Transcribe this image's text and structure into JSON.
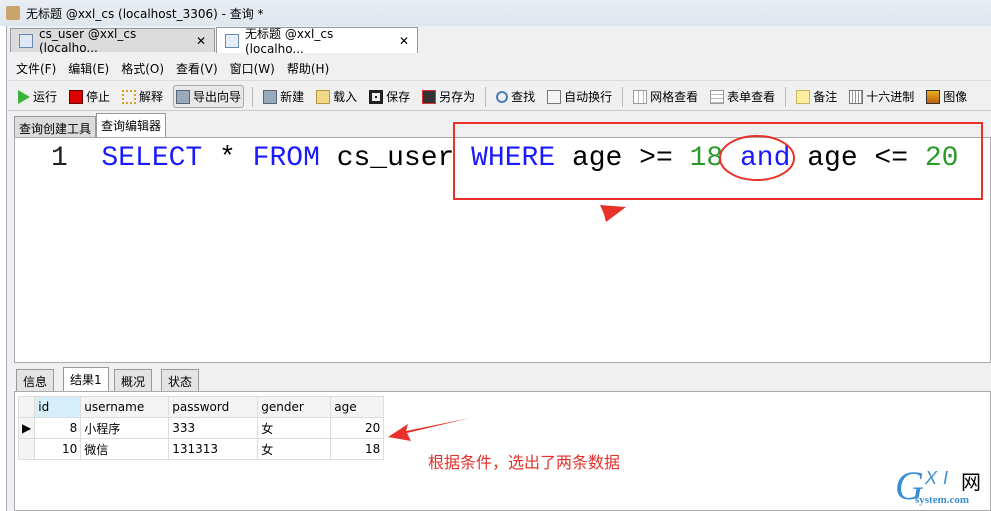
{
  "window": {
    "title": "无标题 @xxl_cs (localhost_3306) - 查询 *"
  },
  "doc_tabs": [
    {
      "label": "cs_user @xxl_cs (localho...",
      "close": "✕"
    },
    {
      "label": "无标题 @xxl_cs (localho...",
      "close": "✕"
    }
  ],
  "menu": [
    "文件(F)",
    "编辑(E)",
    "格式(O)",
    "查看(V)",
    "窗口(W)",
    "帮助(H)"
  ],
  "toolbar": [
    {
      "label": "运行",
      "icon": "run-icon"
    },
    {
      "label": "停止",
      "icon": "stop-icon"
    },
    {
      "label": "解释",
      "icon": "explain-icon"
    },
    {
      "label": "导出向导",
      "icon": "export-icon"
    },
    {
      "label": "新建",
      "icon": "new-icon"
    },
    {
      "label": "载入",
      "icon": "folder-icon"
    },
    {
      "label": "保存",
      "icon": "save-icon"
    },
    {
      "label": "另存为",
      "icon": "save-as-icon"
    },
    {
      "label": "查找",
      "icon": "search-icon"
    },
    {
      "label": "自动换行",
      "icon": "wrap-icon"
    },
    {
      "label": "网格查看",
      "icon": "grid-icon"
    },
    {
      "label": "表单查看",
      "icon": "form-icon"
    },
    {
      "label": "备注",
      "icon": "note-icon"
    },
    {
      "label": "十六进制",
      "icon": "hex-icon"
    },
    {
      "label": "图像",
      "icon": "image-icon"
    }
  ],
  "editor_tabs": [
    "查询创建工具",
    "查询编辑器"
  ],
  "editor": {
    "line_number": "1",
    "tokens": [
      {
        "t": "SELECT",
        "c": "kw"
      },
      {
        "t": " * ",
        "c": ""
      },
      {
        "t": "FROM",
        "c": "kw"
      },
      {
        "t": " cs_user ",
        "c": ""
      },
      {
        "t": "WHERE",
        "c": "kw"
      },
      {
        "t": " age >= ",
        "c": ""
      },
      {
        "t": "18",
        "c": "num"
      },
      {
        "t": " ",
        "c": ""
      },
      {
        "t": "and",
        "c": "kw"
      },
      {
        "t": " age <= ",
        "c": ""
      },
      {
        "t": "20",
        "c": "num"
      }
    ]
  },
  "result_tabs": [
    "信息",
    "结果1",
    "概况",
    "状态"
  ],
  "grid": {
    "columns": [
      "id",
      "username",
      "password",
      "gender",
      "age"
    ],
    "rows": [
      [
        "8",
        "小程序",
        "333",
        "女",
        "20"
      ],
      [
        "10",
        "微信",
        "131313",
        "女",
        "18"
      ]
    ]
  },
  "annotation": {
    "text": "根据条件，选出了两条数据",
    "color": "#e8312a"
  },
  "watermark": {
    "logo": "GXI网",
    "sub": "system.com"
  }
}
